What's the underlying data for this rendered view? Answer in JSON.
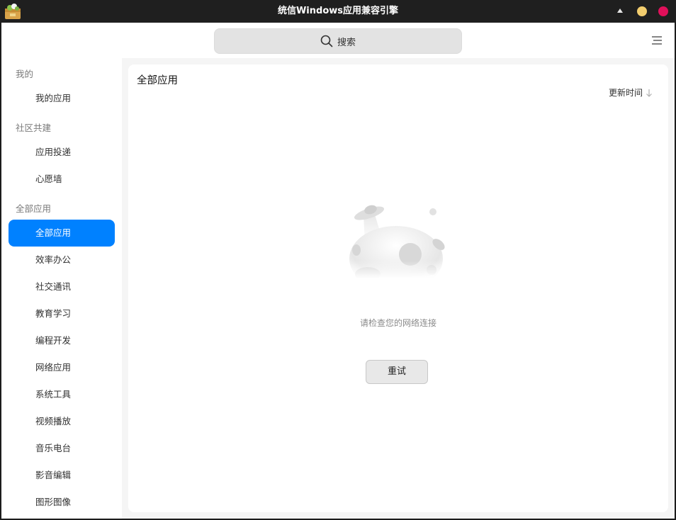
{
  "window": {
    "title": "统信Windows应用兼容引擎",
    "colors": {
      "titlebar": "#1f1f1f",
      "minimize": "#f2cd6e",
      "close": "#e0105a",
      "accent": "#0081ff"
    }
  },
  "search": {
    "label": "搜索",
    "icon": "search-icon"
  },
  "sidebar": {
    "groups": [
      {
        "title": "我的",
        "items": [
          "我的应用"
        ]
      },
      {
        "title": "社区共建",
        "items": [
          "应用投递",
          "心愿墙"
        ]
      },
      {
        "title": "全部应用",
        "items": [
          "全部应用",
          "效率办公",
          "社交通讯",
          "教育学习",
          "编程开发",
          "网络应用",
          "系统工具",
          "视频播放",
          "音乐电台",
          "影音编辑",
          "图形图像"
        ]
      }
    ],
    "selected": "全部应用"
  },
  "main": {
    "title": "全部应用",
    "sort_label": "更新时间",
    "empty_message": "请检查您的网络连接",
    "retry_label": "重试"
  }
}
